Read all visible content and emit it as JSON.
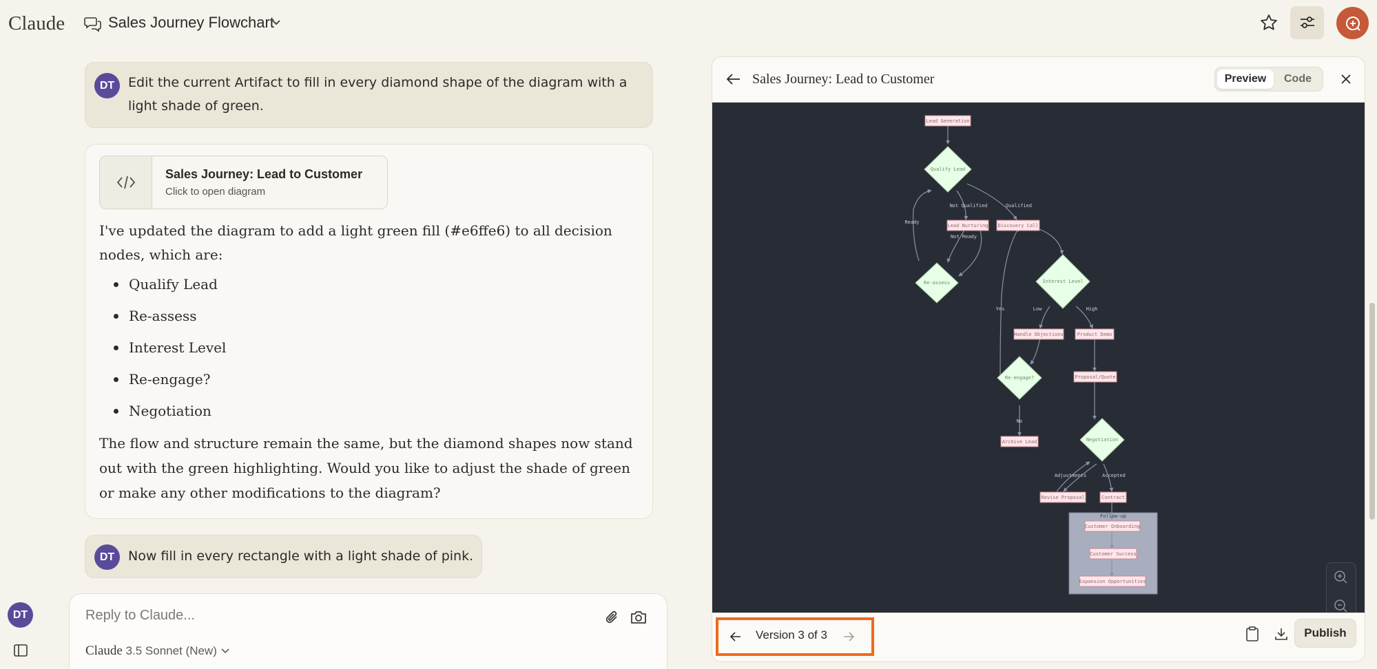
{
  "app": {
    "logo": "Claude"
  },
  "header": {
    "chat_title": "Sales Journey Flowchart"
  },
  "messages": {
    "user1": {
      "initials": "DT",
      "line1": "Edit the current Artifact to fill in every diamond shape of the diagram with a",
      "line2": "light shade of green."
    },
    "assistant": {
      "artifact_title": "Sales Journey: Lead to Customer",
      "artifact_subtitle": "Click to open diagram",
      "intro_line1": "I've updated the diagram to add a light green fill (#e6ffe6) to all decision",
      "intro_line2": "nodes, which are:",
      "bullets": [
        "Qualify Lead",
        "Re-assess",
        "Interest Level",
        "Re-engage?",
        "Negotiation"
      ],
      "outro_line1": "The flow and structure remain the same, but the diamond shapes now stand",
      "outro_line2": "out with the green highlighting. Would you like to adjust the shade of green",
      "outro_line3": "or make any other modifications to the diagram?"
    },
    "user2": {
      "initials": "DT",
      "text": "Now fill in every rectangle with a light shade of pink."
    }
  },
  "input": {
    "placeholder": "Reply to Claude...",
    "model_name": "Claude",
    "model_version": "3.5 Sonnet (New)"
  },
  "sidebar": {
    "avatar_initials": "DT"
  },
  "artifact_panel": {
    "title": "Sales Journey: Lead to Customer",
    "tabs": {
      "preview": "Preview",
      "code": "Code"
    },
    "version_label": "Version 3 of 3",
    "publish_label": "Publish"
  },
  "diagram": {
    "colors": {
      "background": "#282c34",
      "rect_fill": "#ffe6ea",
      "rect_stroke": "#c98b95",
      "diamond_fill": "#e6ffe6",
      "edge": "#8a93a6",
      "subgraph": "#a8aebd",
      "text": "#9aa3b5"
    },
    "nodes": {
      "lead_generation": "Lead Generation",
      "qualify_lead": "Qualify Lead",
      "lead_nurturing": "Lead Nurturing",
      "discovery_call": "Discovery Call",
      "reassess": "Re-assess",
      "interest_level": "Interest Level",
      "handle_objections": "Handle Objections",
      "product_demo": "Product Demo",
      "reengage": "Re-engage?",
      "proposal_quote": "Proposal/Quote",
      "archive_lead": "Archive Lead",
      "negotiation": "Negotiation",
      "revise_proposal": "Revise Proposal",
      "contract": "Contract",
      "customer_onboarding": "Customer Onboarding",
      "customer_success": "Customer Success",
      "expansion_opportunities": "Expansion Opportunities"
    },
    "edge_labels": {
      "not_qualified": "Not Qualified",
      "qualified": "Qualified",
      "ready": "Ready",
      "not_ready": "Not Ready",
      "yes": "Yes",
      "low": "Low",
      "high": "High",
      "no": "No",
      "adjustments": "Adjustments",
      "accepted": "Accepted",
      "follow_up": "Follow-up"
    }
  }
}
